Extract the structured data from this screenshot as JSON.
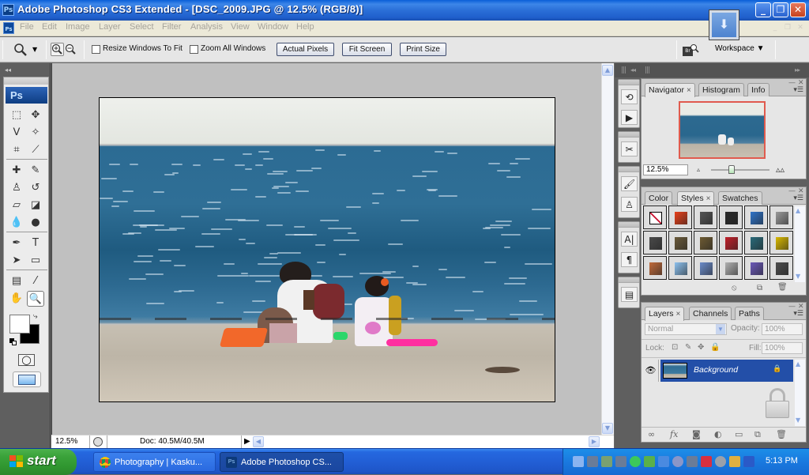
{
  "window": {
    "title": "Adobe Photoshop CS3 Extended - [DSC_2009.JPG @ 12.5% (RGB/8)]",
    "app_badge": "Ps",
    "controls": {
      "minimize": "_",
      "restore": "❐",
      "close": "✕"
    }
  },
  "menubar": {
    "icon": "Ps",
    "items": [
      "File",
      "Edit",
      "Image",
      "Layer",
      "Select",
      "Filter",
      "Analysis",
      "View",
      "Window",
      "Help"
    ],
    "doc_controls": {
      "minimize": "_",
      "restore": "❐",
      "close": "✕"
    }
  },
  "options_bar": {
    "tool_icon": "zoom-tool-icon",
    "zoom_in": "+",
    "zoom_out": "−",
    "checkboxes": [
      {
        "label": "Resize Windows To Fit",
        "checked": false
      },
      {
        "label": "Zoom All Windows",
        "checked": false
      }
    ],
    "buttons": [
      "Actual Pixels",
      "Fit Screen",
      "Print Size"
    ],
    "bridge_icon": "Br",
    "workspace_label": "Workspace ▼"
  },
  "toolbox": {
    "header": "Ps",
    "tools": [
      {
        "name": "rectangular-marquee",
        "glyph": "⬚"
      },
      {
        "name": "move",
        "glyph": "✥"
      },
      {
        "name": "lasso",
        "glyph": "ᐯ"
      },
      {
        "name": "magic-wand",
        "glyph": "✧"
      },
      {
        "name": "crop",
        "glyph": "⌗"
      },
      {
        "name": "slice",
        "glyph": "⟋"
      },
      {
        "name": "healing-brush",
        "glyph": "✚"
      },
      {
        "name": "brush",
        "glyph": "✎"
      },
      {
        "name": "clone-stamp",
        "glyph": "♙"
      },
      {
        "name": "history-brush",
        "glyph": "↺"
      },
      {
        "name": "eraser",
        "glyph": "▱"
      },
      {
        "name": "paint-bucket",
        "glyph": "◪"
      },
      {
        "name": "blur",
        "glyph": "💧"
      },
      {
        "name": "dodge",
        "glyph": "●"
      },
      {
        "name": "pen",
        "glyph": "✒"
      },
      {
        "name": "type",
        "glyph": "T"
      },
      {
        "name": "path-selection",
        "glyph": "➤"
      },
      {
        "name": "rectangle-shape",
        "glyph": "▭"
      },
      {
        "name": "notes",
        "glyph": "▤"
      },
      {
        "name": "eyedropper",
        "glyph": "⁄"
      },
      {
        "name": "hand",
        "glyph": "✋"
      },
      {
        "name": "zoom",
        "glyph": "🔍",
        "active": true
      }
    ],
    "foreground_color": "#ffffff",
    "background_color": "#000000",
    "quick_mask": "◯",
    "screen_mode": "▭"
  },
  "document": {
    "filename": "DSC_2009.JPG",
    "zoom": "12.5%",
    "doc_size": "Doc: 40.5M/40.5M"
  },
  "right_dock": {
    "icon_strip": [
      {
        "name": "history-icon",
        "glyph": "⟲"
      },
      {
        "name": "actions-icon",
        "glyph": "▶"
      },
      {
        "name": "tool-presets-icon",
        "glyph": "✂"
      },
      {
        "name": "brushes-icon",
        "glyph": "🖌"
      },
      {
        "name": "clone-source-icon",
        "glyph": "♙"
      },
      {
        "name": "character-icon",
        "glyph": "A|"
      },
      {
        "name": "paragraph-icon",
        "glyph": "¶"
      },
      {
        "name": "layer-comps-icon",
        "glyph": "▤"
      }
    ],
    "navigator": {
      "tabs": [
        "Navigator",
        "Histogram",
        "Info"
      ],
      "active_tab": "Navigator",
      "zoom_value": "12.5%",
      "zoom_slider_position": 0.35
    },
    "styles": {
      "tabs": [
        "Color",
        "Styles",
        "Swatches"
      ],
      "active_tab": "Styles",
      "swatches": [
        {
          "name": "none",
          "color": "#ffffff"
        },
        {
          "name": "blanket",
          "color": "#e8401a"
        },
        {
          "name": "dark-gray",
          "color": "#555555"
        },
        {
          "name": "black-circle",
          "color": "#2a2a2a"
        },
        {
          "name": "blue-glass",
          "color": "#2f74c9"
        },
        {
          "name": "light-gray",
          "color": "#9a9a9a"
        },
        {
          "name": "gray-gradient",
          "color": "#4a4a4a"
        },
        {
          "name": "brown",
          "color": "#6a5a3a"
        },
        {
          "name": "olive-brown",
          "color": "#6d5a32"
        },
        {
          "name": "red-stripes",
          "color": "#c0202a"
        },
        {
          "name": "rainbow",
          "color": "#2a6a7a"
        },
        {
          "name": "gold",
          "color": "#d8b800"
        },
        {
          "name": "sunset",
          "color": "#c06a3a"
        },
        {
          "name": "sky-blue",
          "color": "#8cc0ee"
        },
        {
          "name": "landscape",
          "color": "#6a8ac8"
        },
        {
          "name": "noise",
          "color": "#b0b0b0"
        },
        {
          "name": "purple",
          "color": "#6a58b8"
        },
        {
          "name": "charcoal",
          "color": "#4c4c4c"
        }
      ]
    },
    "layers": {
      "tabs": [
        "Layers",
        "Channels",
        "Paths"
      ],
      "active_tab": "Layers",
      "blend_mode": "Normal",
      "opacity_label": "Opacity:",
      "opacity_value": "100%",
      "lock_label": "Lock:",
      "fill_label": "Fill:",
      "fill_value": "100%",
      "items": [
        {
          "name": "Background",
          "visible": true,
          "locked": true,
          "selected": true
        }
      ]
    }
  },
  "taskbar": {
    "start_label": "start",
    "tasks": [
      {
        "label": "Photography | Kasku...",
        "icon": "chrome-icon",
        "active": false
      },
      {
        "label": "Adobe Photoshop CS...",
        "icon": "Ps",
        "active": true
      }
    ],
    "clock": "5:13 PM"
  }
}
